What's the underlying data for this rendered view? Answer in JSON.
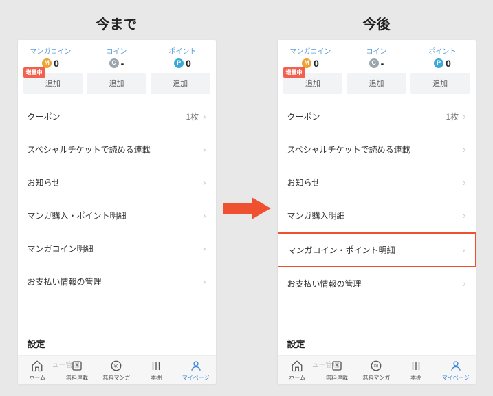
{
  "panels": {
    "before": {
      "title": "今まで"
    },
    "after": {
      "title": "今後"
    }
  },
  "balance": {
    "cols": [
      {
        "label": "マンガコイン",
        "badge": "M",
        "value": "0"
      },
      {
        "label": "コイン",
        "badge": "C",
        "value": "-"
      },
      {
        "label": "ポイント",
        "badge": "P",
        "value": "0"
      }
    ],
    "add_label": "追加",
    "promo": "増量中"
  },
  "list_before": [
    {
      "label": "クーポン",
      "right": "1枚"
    },
    {
      "label": "スペシャルチケットで読める連載"
    },
    {
      "label": "お知らせ"
    },
    {
      "label": "マンガ購入・ポイント明細"
    },
    {
      "label": "マンガコイン明細"
    },
    {
      "label": "お支払い情報の管理"
    }
  ],
  "list_after": [
    {
      "label": "クーポン",
      "right": "1枚"
    },
    {
      "label": "スペシャルチケットで読める連載"
    },
    {
      "label": "お知らせ"
    },
    {
      "label": "マンガ購入明細"
    },
    {
      "label": "マンガコイン・ポイント明細",
      "highlight": true
    },
    {
      "label": "お支払い情報の管理"
    }
  ],
  "section_title": "設定",
  "overlay_text": "ュー管理",
  "tabs": [
    {
      "label": "ホーム",
      "icon": "home"
    },
    {
      "label": "無料連載",
      "icon": "serial"
    },
    {
      "label": "無料マンガ",
      "icon": "free"
    },
    {
      "label": "本棚",
      "icon": "shelf"
    },
    {
      "label": "マイページ",
      "icon": "mypage",
      "active": true
    }
  ]
}
